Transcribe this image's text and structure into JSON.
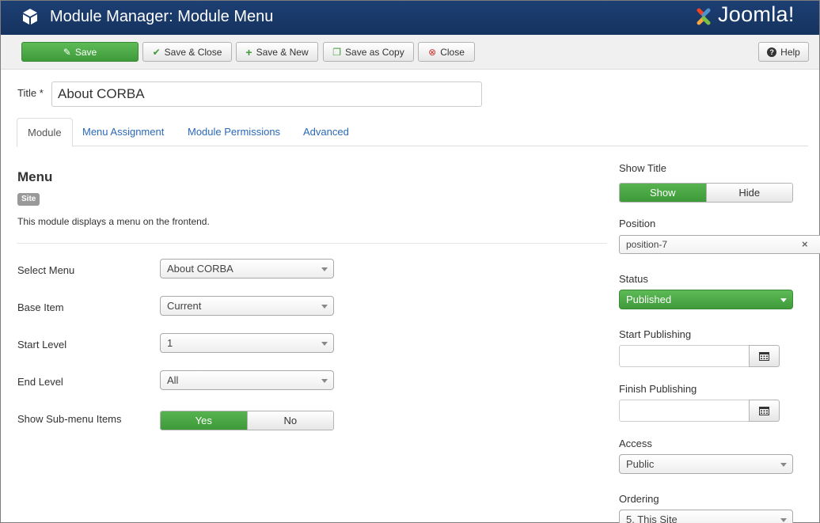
{
  "header": {
    "title": "Module Manager: Module Menu",
    "logo_text": "Joomla!"
  },
  "toolbar": {
    "save": "Save",
    "save_close": "Save & Close",
    "save_new": "Save & New",
    "save_copy": "Save as Copy",
    "close": "Close",
    "help": "Help"
  },
  "form": {
    "title_label": "Title *",
    "title_value": "About CORBA"
  },
  "tabs": [
    "Module",
    "Menu Assignment",
    "Module Permissions",
    "Advanced"
  ],
  "module": {
    "heading": "Menu",
    "badge": "Site",
    "description": "This module displays a menu on the frontend.",
    "fields": {
      "select_menu": {
        "label": "Select Menu",
        "value": "About CORBA"
      },
      "base_item": {
        "label": "Base Item",
        "value": "Current"
      },
      "start_level": {
        "label": "Start Level",
        "value": "1"
      },
      "end_level": {
        "label": "End Level",
        "value": "All"
      },
      "show_submenu": {
        "label": "Show Sub-menu Items",
        "yes": "Yes",
        "no": "No",
        "selected": "Yes"
      }
    }
  },
  "sidebar": {
    "show_title": {
      "label": "Show Title",
      "show": "Show",
      "hide": "Hide",
      "selected": "Show"
    },
    "position": {
      "label": "Position",
      "value": "position-7",
      "clear": "×"
    },
    "status": {
      "label": "Status",
      "value": "Published"
    },
    "start_publishing": {
      "label": "Start Publishing",
      "value": ""
    },
    "finish_publishing": {
      "label": "Finish Publishing",
      "value": ""
    },
    "access": {
      "label": "Access",
      "value": "Public"
    },
    "ordering": {
      "label": "Ordering",
      "value": "5. This Site"
    }
  },
  "colors": {
    "header_bg": "#1d3f73",
    "accent_green": "#46a546",
    "link_blue": "#2a69b8"
  }
}
